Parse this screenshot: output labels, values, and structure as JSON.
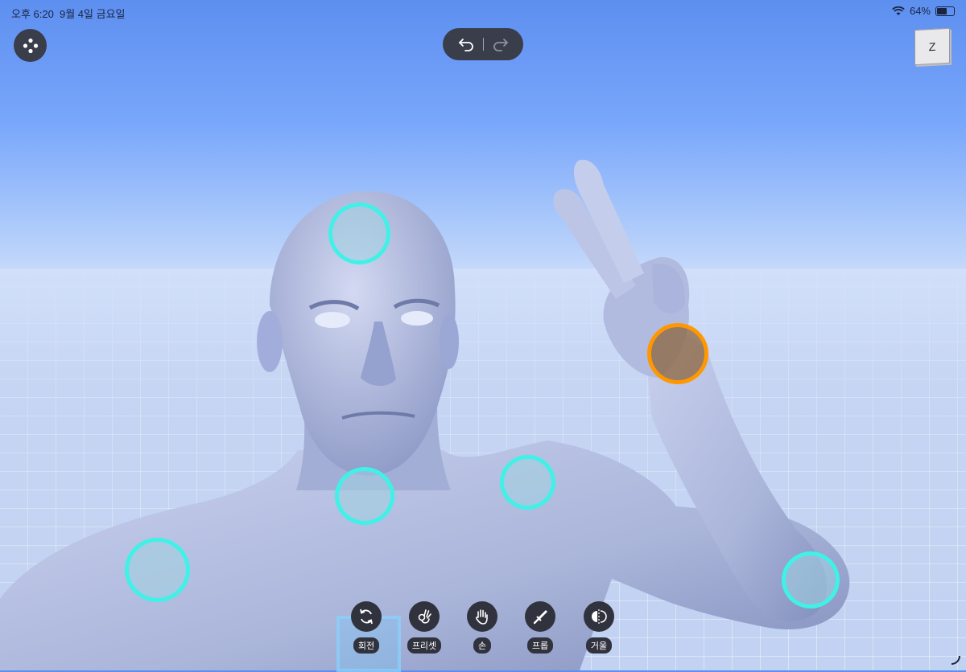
{
  "status": {
    "time": "오후 6:20",
    "date": "9월 4일 금요일",
    "battery_label": "64%",
    "battery_level": 0.64
  },
  "top": {
    "menu_icon": "dots-menu-icon",
    "undo_icon": "undo-icon",
    "redo_icon": "redo-icon",
    "view_cube_label": "Z"
  },
  "toolbar": {
    "tools": [
      {
        "label": "회전",
        "icon": "rotate-icon"
      },
      {
        "label": "프리셋",
        "icon": "ok-hand-icon"
      },
      {
        "label": "손",
        "icon": "hand-icon"
      },
      {
        "label": "프롭",
        "icon": "sword-icon"
      },
      {
        "label": "거울",
        "icon": "mirror-icon"
      }
    ],
    "selected": "회전"
  },
  "colors": {
    "joint": "#3ff1e6",
    "joint_active": "#ff9800",
    "control_bg": "#3a3d4a",
    "sky_top": "#5d8ff0",
    "model_skin": "#b9c3e3"
  }
}
